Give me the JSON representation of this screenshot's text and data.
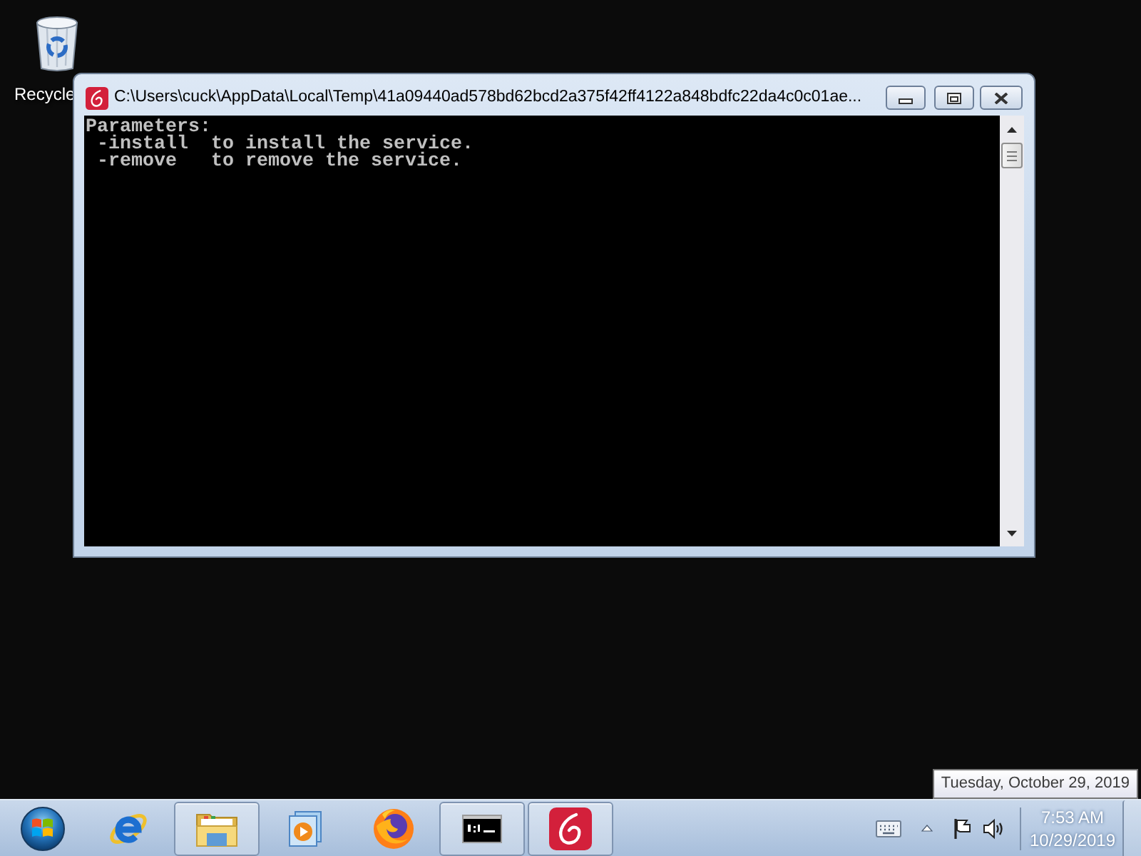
{
  "desktop": {
    "icons": [
      {
        "label": "Recycle"
      }
    ]
  },
  "window": {
    "title": "C:\\Users\\cuck\\AppData\\Local\\Temp\\41a09440ad578bd62bcd2a375f42ff4122a848bdfc22da4c0c01ae...",
    "console_lines": [
      "Parameters:",
      " -install  to install the service.",
      " -remove   to remove the service."
    ]
  },
  "tooltip": "Tuesday, October 29, 2019",
  "taskbar": {
    "apps": [
      {
        "kind": "ie",
        "running": false
      },
      {
        "kind": "explorer",
        "running": true
      },
      {
        "kind": "media",
        "running": false
      },
      {
        "kind": "firefox",
        "running": false
      },
      {
        "kind": "console",
        "running": true
      },
      {
        "kind": "swirl",
        "running": true
      }
    ],
    "clock": {
      "time": "7:53 AM",
      "date": "10/29/2019"
    }
  }
}
